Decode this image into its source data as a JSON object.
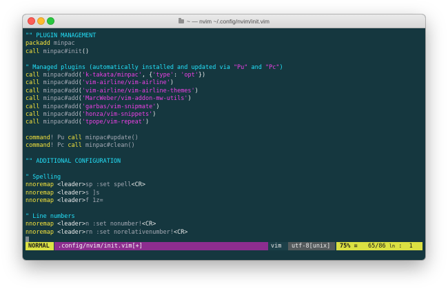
{
  "window": {
    "title": "~ — nvim ~/.config/nvim/init.vim"
  },
  "editor": {
    "lines": [
      [
        {
          "t": "\"\" PLUGIN MANAGEMENT",
          "c": "cmt"
        }
      ],
      [
        {
          "t": "packadd",
          "c": "kw"
        },
        {
          "t": " minpac",
          "c": "plain"
        }
      ],
      [
        {
          "t": "call",
          "c": "kw"
        },
        {
          "t": " minpac#init",
          "c": "plain"
        },
        {
          "t": "()",
          "c": "wht"
        }
      ],
      [],
      [
        {
          "t": "\" Managed plugins (automatically installed and updated via ",
          "c": "cmt"
        },
        {
          "t": "\"Pu\"",
          "c": "str"
        },
        {
          "t": " and ",
          "c": "cmt"
        },
        {
          "t": "\"Pc\"",
          "c": "str"
        },
        {
          "t": ")",
          "c": "cmt"
        }
      ],
      [
        {
          "t": "call",
          "c": "kw"
        },
        {
          "t": " minpac#add",
          "c": "plain"
        },
        {
          "t": "(",
          "c": "wht"
        },
        {
          "t": "'k-takata/minpac'",
          "c": "str"
        },
        {
          "t": ", {",
          "c": "wht"
        },
        {
          "t": "'type'",
          "c": "str"
        },
        {
          "t": ": ",
          "c": "wht"
        },
        {
          "t": "'opt'",
          "c": "str"
        },
        {
          "t": "})",
          "c": "wht"
        }
      ],
      [
        {
          "t": "call",
          "c": "kw"
        },
        {
          "t": " minpac#add",
          "c": "plain"
        },
        {
          "t": "(",
          "c": "wht"
        },
        {
          "t": "'vim-airline/vim-airline'",
          "c": "str"
        },
        {
          "t": ")",
          "c": "wht"
        }
      ],
      [
        {
          "t": "call",
          "c": "kw"
        },
        {
          "t": " minpac#add",
          "c": "plain"
        },
        {
          "t": "(",
          "c": "wht"
        },
        {
          "t": "'vim-airline/vim-airline-themes'",
          "c": "str"
        },
        {
          "t": ")",
          "c": "wht"
        }
      ],
      [
        {
          "t": "call",
          "c": "kw"
        },
        {
          "t": " minpac#add",
          "c": "plain"
        },
        {
          "t": "(",
          "c": "wht"
        },
        {
          "t": "'MarcWeber/vim-addon-mw-utils'",
          "c": "str"
        },
        {
          "t": ")",
          "c": "wht"
        }
      ],
      [
        {
          "t": "call",
          "c": "kw"
        },
        {
          "t": " minpac#add",
          "c": "plain"
        },
        {
          "t": "(",
          "c": "wht"
        },
        {
          "t": "'garbas/vim-snipmate'",
          "c": "str"
        },
        {
          "t": ")",
          "c": "wht"
        }
      ],
      [
        {
          "t": "call",
          "c": "kw"
        },
        {
          "t": " minpac#add",
          "c": "plain"
        },
        {
          "t": "(",
          "c": "wht"
        },
        {
          "t": "'honza/vim-snippets'",
          "c": "str"
        },
        {
          "t": ")",
          "c": "wht"
        }
      ],
      [
        {
          "t": "call",
          "c": "kw"
        },
        {
          "t": " minpac#add",
          "c": "plain"
        },
        {
          "t": "(",
          "c": "wht"
        },
        {
          "t": "'tpope/vim-repeat'",
          "c": "str"
        },
        {
          "t": ")",
          "c": "wht"
        }
      ],
      [],
      [
        {
          "t": "command",
          "c": "kw"
        },
        {
          "t": "! Pu ",
          "c": "plain"
        },
        {
          "t": "call",
          "c": "kw"
        },
        {
          "t": " minpac#update()",
          "c": "plain"
        }
      ],
      [
        {
          "t": "command",
          "c": "kw"
        },
        {
          "t": "! Pc ",
          "c": "plain"
        },
        {
          "t": "call",
          "c": "kw"
        },
        {
          "t": " minpac#clean()",
          "c": "plain"
        }
      ],
      [],
      [
        {
          "t": "\"\" ADDITIONAL CONFIGURATION",
          "c": "cmt"
        }
      ],
      [],
      [
        {
          "t": "\" Spelling",
          "c": "cmt"
        }
      ],
      [
        {
          "t": "nnoremap",
          "c": "kw"
        },
        {
          "t": " <leader>",
          "c": "wht"
        },
        {
          "t": "sp :set spell",
          "c": "plain"
        },
        {
          "t": "<CR>",
          "c": "wht"
        }
      ],
      [
        {
          "t": "nnoremap",
          "c": "kw"
        },
        {
          "t": " <leader>",
          "c": "wht"
        },
        {
          "t": "s ]s",
          "c": "plain"
        }
      ],
      [
        {
          "t": "nnoremap",
          "c": "kw"
        },
        {
          "t": " <leader>",
          "c": "wht"
        },
        {
          "t": "f 1z=",
          "c": "plain"
        }
      ],
      [],
      [
        {
          "t": "\" Line numbers",
          "c": "cmt"
        }
      ],
      [
        {
          "t": "nnoremap",
          "c": "kw"
        },
        {
          "t": " <leader>",
          "c": "wht"
        },
        {
          "t": "n :set nonumber!",
          "c": "plain"
        },
        {
          "t": "<CR>",
          "c": "wht"
        }
      ],
      [
        {
          "t": "nnoremap",
          "c": "kw"
        },
        {
          "t": " <leader>",
          "c": "wht"
        },
        {
          "t": "rn :set norelativenumber!",
          "c": "plain"
        },
        {
          "t": "<CR>",
          "c": "wht"
        }
      ]
    ]
  },
  "statusline": {
    "mode": "NORMAL",
    "file": ".config/nvim/init.vim[+]",
    "filetype": "vim",
    "encoding": "utf-8[unix]",
    "percent": "75%",
    "position": "65/86",
    "ln_label": "ln",
    "column": ":  1"
  },
  "colors": {
    "background": "#15373f",
    "comment": "#23e1fa",
    "keyword": "#f4e23c",
    "string": "#ee40e6",
    "mode_bg": "#dce244",
    "file_bg": "#8d2d8f"
  }
}
